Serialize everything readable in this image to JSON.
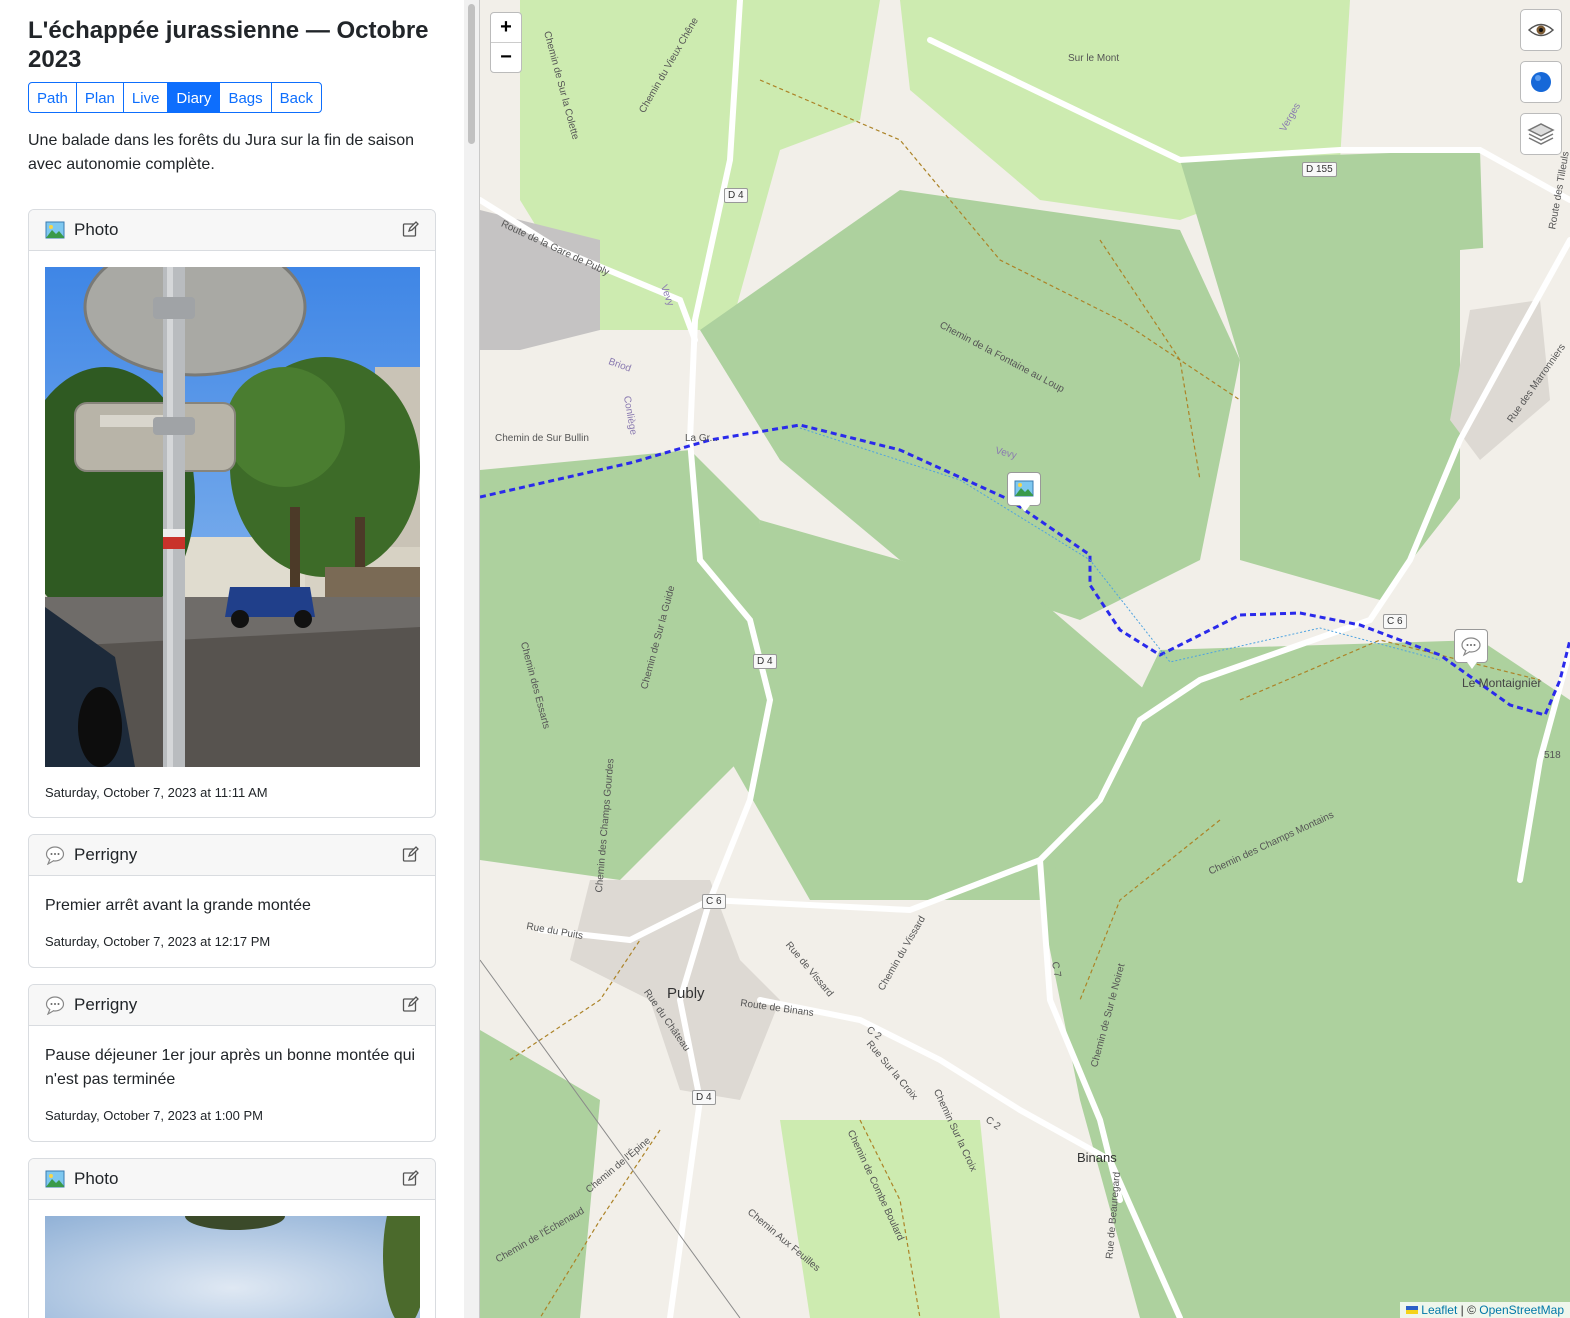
{
  "trip": {
    "title": "L'échappée jurassienne — Octobre 2023",
    "description": "Une balade dans les forêts du Jura sur la fin de saison avec autonomie complète."
  },
  "nav": {
    "tabs": [
      {
        "label": "Path",
        "active": false
      },
      {
        "label": "Plan",
        "active": false
      },
      {
        "label": "Live",
        "active": false
      },
      {
        "label": "Diary",
        "active": true
      },
      {
        "label": "Bags",
        "active": false
      },
      {
        "label": "Back",
        "active": false
      }
    ]
  },
  "diary": [
    {
      "icon": "photo-icon",
      "title": "Photo",
      "date": "Saturday, October 7, 2023 at 11:11 AM"
    },
    {
      "icon": "speech-bubble-icon",
      "title": "Perrigny",
      "text": "Premier arrêt avant la grande montée",
      "date": "Saturday, October 7, 2023 at 12:17 PM"
    },
    {
      "icon": "speech-bubble-icon",
      "title": "Perrigny",
      "text": "Pause déjeuner 1er jour après un bonne montée qui n'est pas terminée",
      "date": "Saturday, October 7, 2023 at 1:00 PM"
    },
    {
      "icon": "photo-icon",
      "title": "Photo"
    }
  ],
  "map": {
    "zoom_in": "+",
    "zoom_out": "−",
    "route_color": "#2a2aeb",
    "places": {
      "publy": "Publy",
      "binans": "Binans",
      "le_montaignier": "Le Montaignier",
      "sur_le_mont": "Sur le Mont",
      "verges": "Verges",
      "briod": "Briod",
      "conliege": "Conliège",
      "vevy": "Vevy",
      "vevy2": "Vevy",
      "la_grange": "La Gr..."
    },
    "roads": {
      "d155": "D 155",
      "d4a": "D 4",
      "d4b": "D 4",
      "d4c": "D 4",
      "c6a": "C 6",
      "c6b": "C 6",
      "c2a": "C 2",
      "c2b": "C 2",
      "c7": "C 7",
      "route_gare": "Route de la Gare de Publy",
      "chemin_bullin": "Chemin de Sur Bullin",
      "chemin_fontaine": "Chemin de la Fontaine au Loup",
      "rue_puits": "Rue du Puits",
      "rue_chateau": "Rue du Château",
      "route_binans": "Route de Binans",
      "rue_croix": "Rue Sur la Croix",
      "chemin_croix": "Chemin Sur la Croix",
      "chemin_vissard": "Chemin du Vissard",
      "rue_vissard": "Rue de Vissard",
      "champs_montains": "Chemin des Champs Montains",
      "chemin_noiret": "Chemin de Sur le Noiret",
      "rue_marronniers": "Rue des Marronniers",
      "route_tilleuls": "Route des Tilleuls",
      "chemin_vieux_chene": "Chemin du Vieux Chêne",
      "chemin_colette": "Chemin de Sur la Colette",
      "chemin_guide": "Chemin de Sur la Guide",
      "chemin_essarts": "Chemin des Essarts",
      "chemin_champs_gourdes": "Chemin des Champs Gourdes",
      "chemin_epine": "Chemin de l'Épine",
      "chemin_echenaud": "Chemin de l'Échenaud",
      "chemin_feuilles": "Chemin Aux Feuilles",
      "chemin_combe": "Chemin de Combe Boulard",
      "rue_beauregard": "Rue de Beauregard",
      "n518": "518"
    },
    "attribution": {
      "leaflet": "Leaflet",
      "separator": " | © ",
      "osm": "OpenStreetMap"
    }
  }
}
